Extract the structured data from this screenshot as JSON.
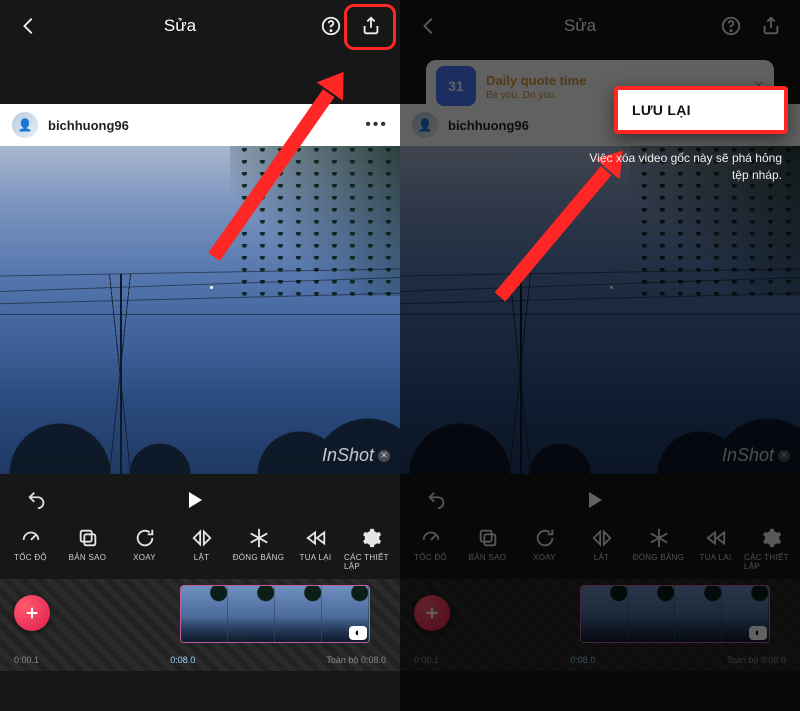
{
  "header": {
    "title": "Sửa",
    "back_icon": "back-icon",
    "help_icon": "help-icon",
    "share_icon": "share-icon"
  },
  "post": {
    "username": "bichhuong96",
    "more": "•••",
    "watermark": "InShot"
  },
  "controls": {
    "undo_icon": "undo-icon",
    "play_icon": "play-icon"
  },
  "tools": [
    {
      "icon": "speed-icon",
      "label": "TỐC ĐỘ"
    },
    {
      "icon": "copy-icon",
      "label": "BẢN SAO"
    },
    {
      "icon": "rotate-icon",
      "label": "XOAY"
    },
    {
      "icon": "flip-icon",
      "label": "LẬT"
    },
    {
      "icon": "freeze-icon",
      "label": "ĐÓNG BĂNG"
    },
    {
      "icon": "rewind-icon",
      "label": "TUA LẠI"
    },
    {
      "icon": "settings-icon",
      "label": "CÁC THIẾT LẬP"
    }
  ],
  "timeline": {
    "add_icon": "plus-icon",
    "start": "0:00.1",
    "end": "0:08.0",
    "total_label": "Toàn bộ",
    "total": "0:08.0"
  },
  "right": {
    "banner_icon": "31",
    "banner_title": "Daily quote time",
    "banner_sub": "Be you. Do you.",
    "popup_label": "LƯU LẠI",
    "warn_text": "Việc xóa video gốc này sẽ phá hỏng tệp nháp."
  }
}
